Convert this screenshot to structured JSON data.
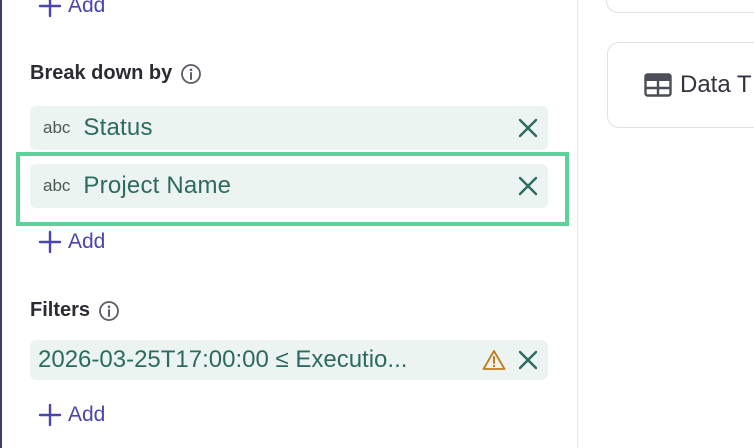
{
  "top_add": {
    "label": "Add"
  },
  "breakdown": {
    "title": "Break down by",
    "items": [
      {
        "type": "abc",
        "label": "Status"
      },
      {
        "type": "abc",
        "label": "Project Name"
      }
    ],
    "add_label": "Add"
  },
  "filters": {
    "title": "Filters",
    "items": [
      {
        "label": "2026-03-25T17:00:00 ≤ Executio...",
        "warning": true
      }
    ],
    "add_label": "Add"
  },
  "right_panel": {
    "card_label": "Data T"
  },
  "colors": {
    "accent": "#4a45b0",
    "chip_bg": "#ecf4f1",
    "chip_text": "#2d6a5f",
    "highlight": "#5ed29c",
    "warning": "#c47a1e"
  }
}
